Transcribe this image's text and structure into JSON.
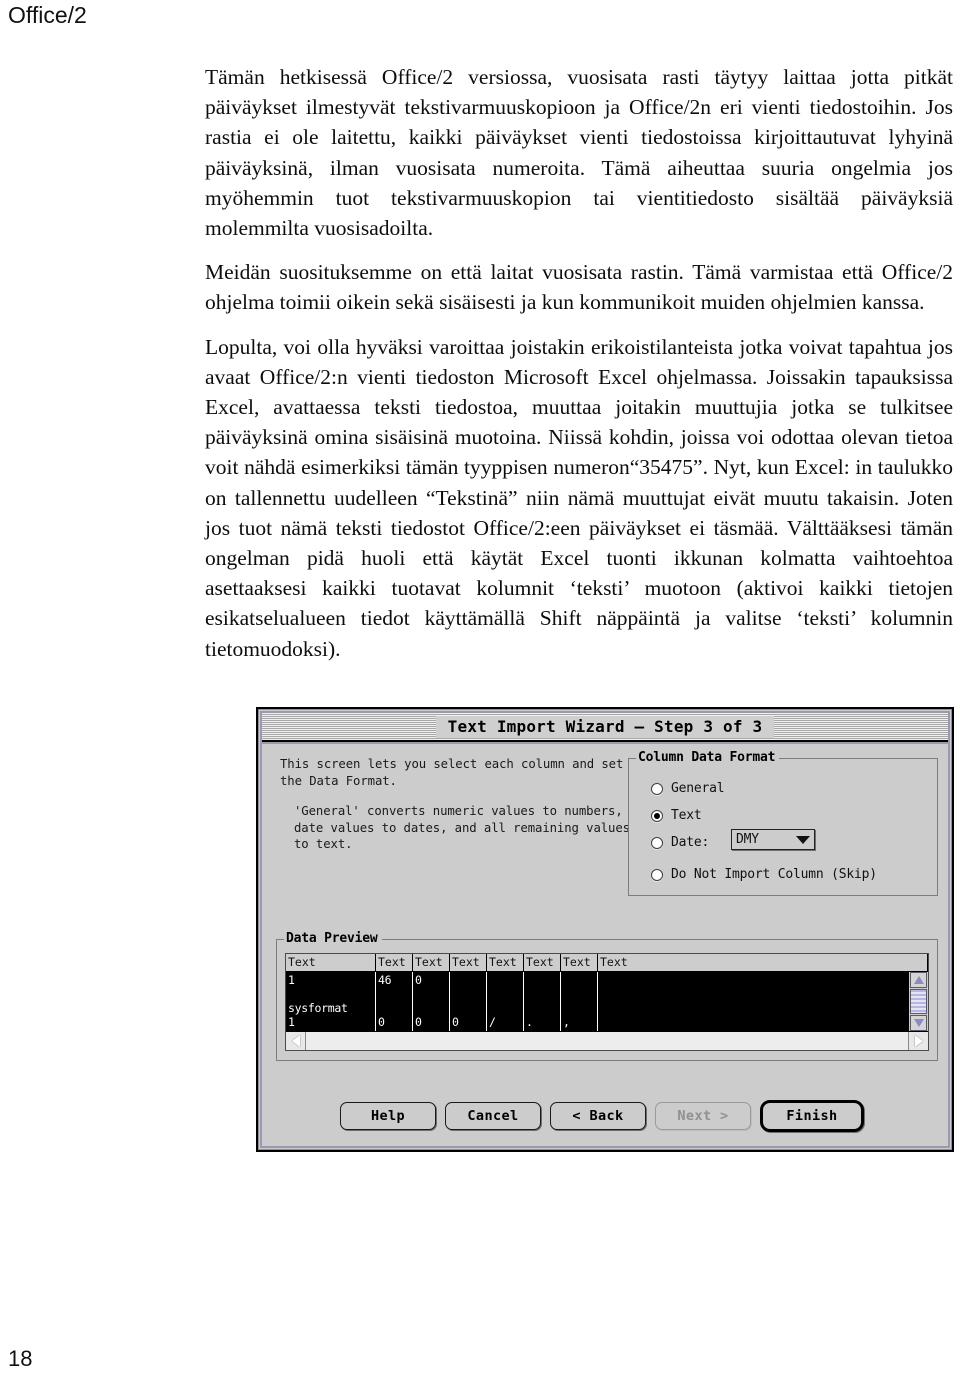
{
  "page": {
    "running_head": "Office/2",
    "page_number": "18"
  },
  "body_text": {
    "paragraphs": [
      "Tämän hetkisessä Office/2 versiossa, vuosisata rasti täytyy laittaa jotta pitkät päiväykset ilmestyvät tekstivarmuuskopioon ja Office/2n eri vienti tiedostoihin. Jos rastia ei ole laitettu, kaikki päiväykset vienti tiedostoissa kirjoittautuvat lyhyinä päiväyksinä, ilman vuosisata numeroita. Tämä aiheuttaa suuria ongelmia jos myöhemmin tuot tekstivarmuuskopion tai vientitiedosto sisältää päiväyksiä molemmilta vuosisadoilta.",
      "Meidän suosituksemme on että  laitat vuosisata rastin. Tämä varmistaa että Office/2 ohjelma toimii oikein sekä sisäisesti ja kun kommunikoit muiden ohjelmien kanssa.",
      "Lopulta, voi olla hyväksi varoittaa joistakin erikoistilanteista jotka voivat tapahtua jos avaat Office/2:n vienti tiedoston Microsoft Excel ohjelmassa. Joissakin tapauksissa Excel, avattaessa teksti tiedostoa, muuttaa joitakin muuttujia jotka se tulkitsee päiväyksinä omina sisäisinä muotoina. Niissä kohdin, joissa voi odottaa olevan tietoa voit nähdä  esimerkiksi tämän tyyppisen numeron“35475”. Nyt, kun Excel: in taulukko on tallennettu uudelleen “Tekstinä” niin nämä muuttujat eivät muutu takaisin. Joten jos tuot nämä teksti tiedostot Office/2:een päiväykset ei täsmää. Välttääksesi tämän ongelman pidä huoli että käytät Excel tuonti ikkunan kolmatta vaihtoehtoa asettaaksesi kaikki tuotavat kolumnit ‘teksti’ muotoon (aktivoi kaikki tietojen esikatselualueen tiedot käyttämällä Shift näppäintä ja valitse ‘teksti’ kolumnin tietomuodoksi)."
    ]
  },
  "dialog": {
    "title": "Text Import Wizard – Step 3 of 3",
    "description": {
      "line1": "This screen lets you select each column and set the Data Format.",
      "line2": "'General' converts numeric values to numbers, date values to dates, and all remaining values to text."
    },
    "column_data_format": {
      "legend": "Column Data Format",
      "options": [
        {
          "label": "General",
          "selected": false
        },
        {
          "label": "Text",
          "selected": true
        },
        {
          "label": "Date:",
          "selected": false
        },
        {
          "label": "Do Not Import Column (Skip)",
          "selected": false
        }
      ],
      "date_format_value": "DMY"
    },
    "data_preview": {
      "legend": "Data Preview",
      "column_headers": [
        "Text",
        "Text",
        "Text",
        "Text",
        "Text",
        "Text",
        "Text",
        "Text"
      ],
      "rows": [
        [
          "1",
          "46",
          "0",
          "",
          "",
          "",
          "",
          ""
        ],
        [
          "",
          "",
          "",
          "",
          "",
          "",
          "",
          ""
        ],
        [
          "sysformat",
          "",
          "",
          "",
          "",
          "",
          "",
          ""
        ],
        [
          "1",
          "0",
          "0",
          "0",
          "/",
          ".",
          ",",
          ""
        ]
      ]
    },
    "buttons": [
      {
        "label": "Help",
        "state": "enabled"
      },
      {
        "label": "Cancel",
        "state": "enabled"
      },
      {
        "label": "< Back",
        "state": "enabled"
      },
      {
        "label": "Next >",
        "state": "disabled"
      },
      {
        "label": "Finish",
        "state": "default"
      }
    ]
  },
  "colors": {
    "dialog_face": "#cccccc",
    "preview_background": "#000000",
    "preview_text": "#ffffff",
    "scrollbar_accent": "#8b8bc4"
  }
}
